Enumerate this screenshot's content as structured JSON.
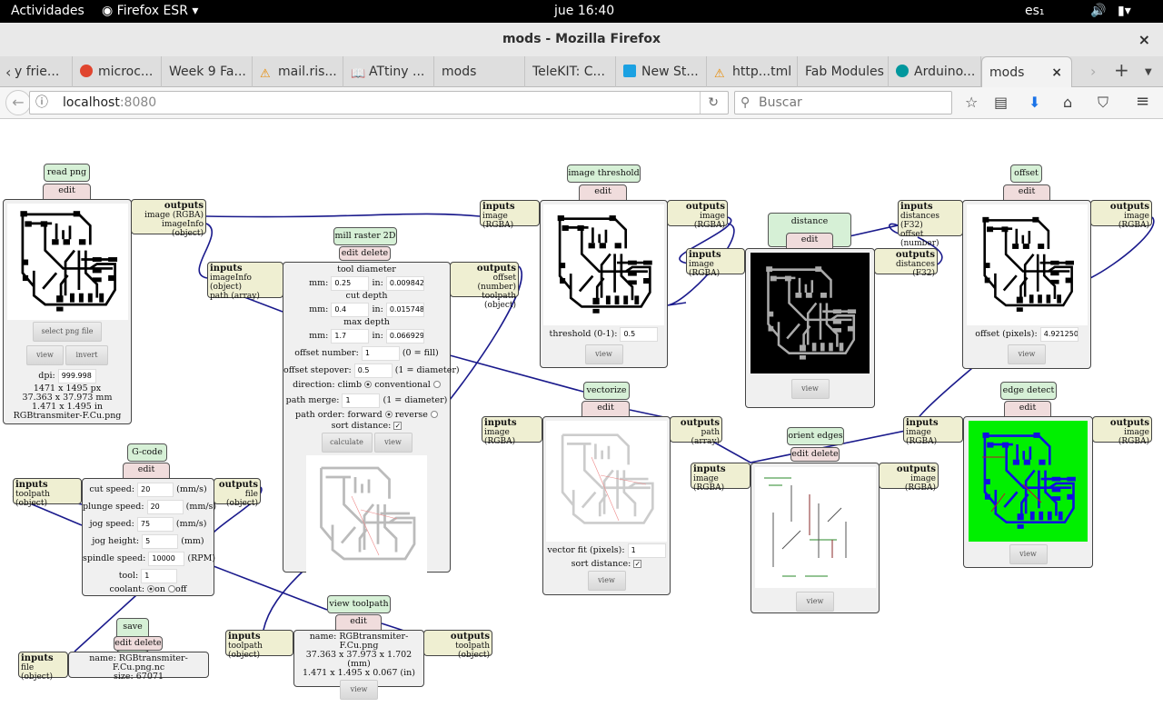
{
  "system": {
    "activities": "Actividades",
    "app": "Firefox ESR ▾",
    "clock": "jue 16:40",
    "lang": "es₁"
  },
  "window": {
    "title": "mods - Mozilla Firefox",
    "close": "×"
  },
  "tabs": [
    {
      "label": "y frie..."
    },
    {
      "label": "microc..."
    },
    {
      "label": "Week 9 Fa..."
    },
    {
      "label": "mail.ris..."
    },
    {
      "label": "ATtiny ..."
    },
    {
      "label": "mods"
    },
    {
      "label": "TeleKIT: C..."
    },
    {
      "label": "New St..."
    },
    {
      "label": "http...tml"
    },
    {
      "label": "Fab Modules"
    },
    {
      "label": "Arduino..."
    },
    {
      "label": "mods",
      "close": "×",
      "active": true
    }
  ],
  "nav": {
    "url_host": "localhost",
    "url_port": ":8080",
    "search_placeholder": "Buscar"
  },
  "common": {
    "edit_delete": "edit delete",
    "inputs": "inputs",
    "outputs": "outputs",
    "view": "view"
  },
  "modules": {
    "read_png": {
      "title": "read png",
      "outputs": [
        "image (RGBA)",
        "imageInfo (object)"
      ],
      "select": "select png file",
      "invert": "invert",
      "dpi_label": "dpi:",
      "dpi": "999.998",
      "px": "1471 x 1495 px",
      "mm": "37.363 x 37.973 mm",
      "in": "1.471 x 1.495 in",
      "file": "RGBtransmiter-F.Cu.png"
    },
    "mill_raster": {
      "title": "mill raster 2D",
      "inputs": [
        "imageInfo (object)",
        "path (array)"
      ],
      "outputs": [
        "offset (number)",
        "toolpath (object)"
      ],
      "tool_diameter": "tool diameter",
      "cut_depth": "cut depth",
      "max_depth": "max depth",
      "mm": "mm:",
      "in": "in:",
      "td_mm": "0.25",
      "td_in": "0.009842",
      "cd_mm": "0.4",
      "cd_in": "0.015748",
      "md_mm": "1.7",
      "md_in": "0.066929",
      "offset_number_label": "offset number:",
      "offset_number": "1",
      "offset_number_hint": "(0 = fill)",
      "stepover_label": "offset stepover:",
      "stepover": "0.5",
      "stepover_hint": "(1 = diameter)",
      "direction_label": "direction: climb",
      "conventional": "conventional",
      "merge_label": "path merge:",
      "merge": "1",
      "merge_hint": "(1 = diameter)",
      "order_label": "path order: forward",
      "reverse": "reverse",
      "sort_label": "sort distance:",
      "calculate": "calculate"
    },
    "image_threshold": {
      "title": "image threshold",
      "inputs": [
        "image (RGBA)"
      ],
      "outputs": [
        "image (RGBA)"
      ],
      "threshold_label": "threshold (0-1):",
      "threshold": "0.5"
    },
    "distance_transform": {
      "title": "distance transform",
      "inputs": [
        "image (RGBA)"
      ],
      "outputs": [
        "distances (F32)"
      ]
    },
    "offset": {
      "title": "offset",
      "inputs": [
        "distances (F32)",
        "offset (number)"
      ],
      "outputs": [
        "image (RGBA)"
      ],
      "offset_label": "offset (pixels):",
      "offset": "4.921250"
    },
    "vectorize": {
      "title": "vectorize",
      "inputs": [
        "image (RGBA)"
      ],
      "outputs": [
        "path (array)"
      ],
      "fit_label": "vector fit (pixels):",
      "fit": "1",
      "sort_label": "sort distance:"
    },
    "orient_edges": {
      "title": "orient edges",
      "inputs": [
        "image (RGBA)"
      ],
      "outputs": [
        "image (RGBA)"
      ]
    },
    "edge_detect": {
      "title": "edge detect",
      "inputs": [
        "image (RGBA)"
      ],
      "outputs": [
        "image (RGBA)"
      ]
    },
    "gcode": {
      "title": "G-code",
      "inputs": [
        "toolpath (object)"
      ],
      "outputs": [
        "file (object)"
      ],
      "cut_label": "cut speed:",
      "cut": "20",
      "cut_unit": "(mm/s)",
      "plunge_label": "plunge speed:",
      "plunge": "20",
      "plunge_unit": "(mm/s)",
      "jog_label": "jog speed:",
      "jog": "75",
      "jog_unit": "(mm/s)",
      "height_label": "jog height:",
      "height": "5",
      "height_unit": "(mm)",
      "spindle_label": "spindle speed:",
      "spindle": "10000",
      "spindle_unit": "(RPM)",
      "tool_label": "tool:",
      "tool": "1",
      "coolant_label": "coolant:",
      "on": "on",
      "off": "off"
    },
    "save_file": {
      "title": "save file",
      "inputs": [
        "file (object)"
      ],
      "name": "name: RGBtransmiter-F.Cu.png.nc",
      "size": "size: 67071"
    },
    "view_toolpath": {
      "title": "view toolpath",
      "inputs": [
        "toolpath (object)"
      ],
      "outputs": [
        "toolpath (object)"
      ],
      "name": "name: RGBtransmiter-F.Cu.png",
      "mm": "37.363 x 37.973 x 1.702 (mm)",
      "in": "1.471 x 1.495 x 0.067 (in)"
    }
  },
  "colors": {
    "wire": "#1a1a8c",
    "title_bg": "#d6f0d6",
    "edit_bg": "#f0dcdc",
    "io_bg": "#efefd2"
  }
}
